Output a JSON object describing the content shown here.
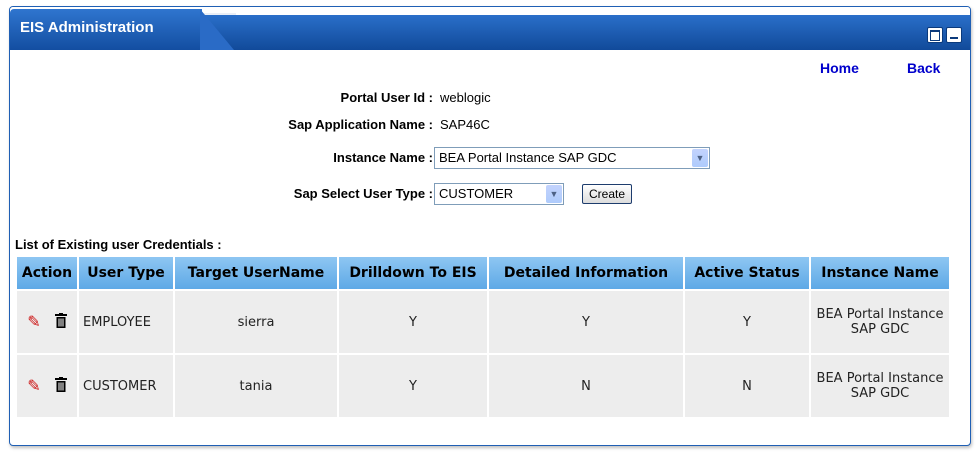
{
  "portlet": {
    "title": "EIS Administration"
  },
  "nav": {
    "home": "Home",
    "back": "Back"
  },
  "form": {
    "portal_user_id_label": "Portal User Id :",
    "portal_user_id_value": "weblogic",
    "sap_app_name_label": "Sap Application Name :",
    "sap_app_name_value": "SAP46C",
    "instance_name_label": "Instance Name :",
    "instance_name_value": "BEA Portal Instance SAP GDC",
    "user_type_label": "Sap Select User Type :",
    "user_type_value": "CUSTOMER",
    "create_label": "Create"
  },
  "list": {
    "title": "List of Existing user Credentials :",
    "columns": [
      "Action",
      "User Type",
      "Target UserName",
      "Drilldown To EIS",
      "Detailed Information",
      "Active Status",
      "Instance Name"
    ],
    "rows": [
      {
        "user_type": "EMPLOYEE",
        "target_username": "sierra",
        "drilldown": "Y",
        "detailed": "Y",
        "active": "Y",
        "instance_name": "BEA Portal Instance SAP GDC"
      },
      {
        "user_type": "CUSTOMER",
        "target_username": "tania",
        "drilldown": "Y",
        "detailed": "N",
        "active": "N",
        "instance_name": "BEA Portal Instance SAP GDC"
      }
    ]
  },
  "colors": {
    "title_bar": "#1a5db5",
    "link": "#0000cc",
    "header_bg": "#6fb3ec",
    "row_bg": "#ededed"
  },
  "icons": {
    "edit": "pencil-icon",
    "delete": "trash-icon",
    "maximize": "maximize-icon",
    "minimize": "minimize-icon"
  }
}
